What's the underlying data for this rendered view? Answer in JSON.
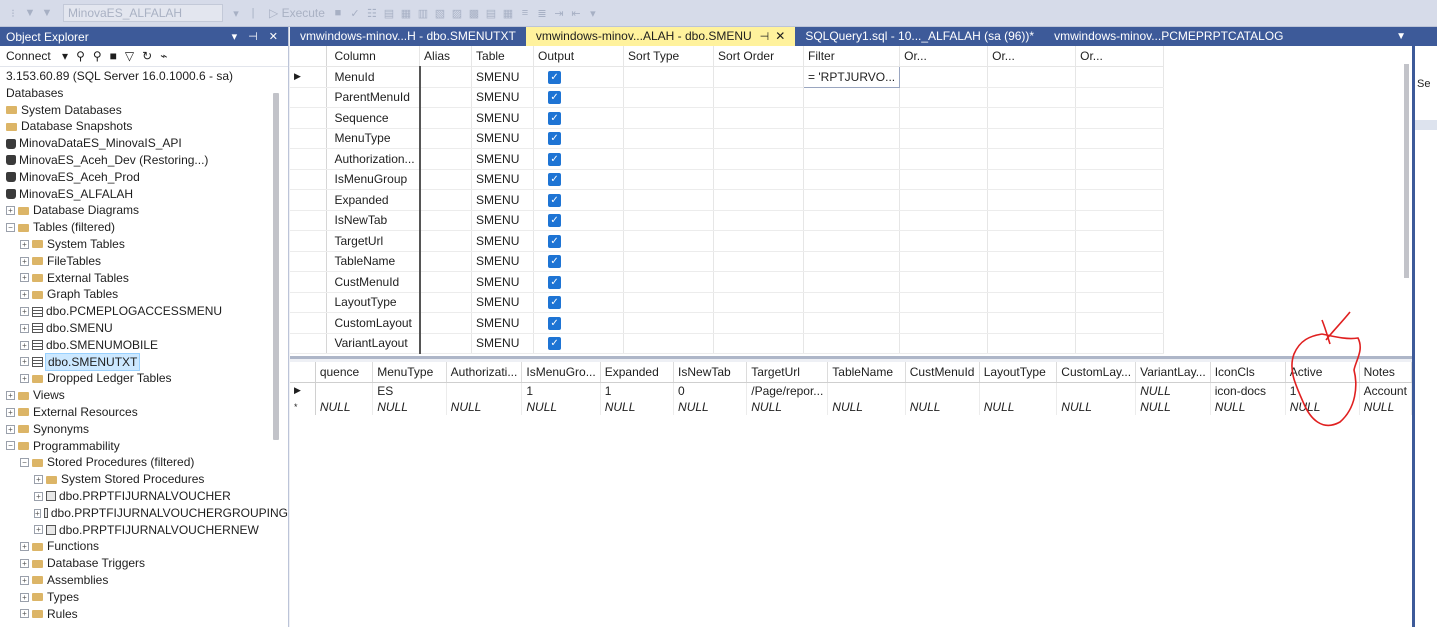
{
  "toolbar": {
    "database": "MinovaES_ALFALAH",
    "execute_label": "Execute"
  },
  "object_explorer": {
    "title": "Object Explorer",
    "connect_label": "Connect",
    "nodes": [
      {
        "label": "3.153.60.89 (SQL Server 16.0.1000.6 - sa)",
        "icon": "server-icon",
        "indent": 0,
        "expander": ""
      },
      {
        "label": "Databases",
        "icon": "",
        "indent": 0,
        "expander": ""
      },
      {
        "label": "System Databases",
        "icon": "folder-icon",
        "indent": 0,
        "expander": ""
      },
      {
        "label": "Database Snapshots",
        "icon": "folder-icon",
        "indent": 0,
        "expander": ""
      },
      {
        "label": "MinovaDataES_MinovaIS_API",
        "icon": "database-icon",
        "indent": 0,
        "expander": ""
      },
      {
        "label": "MinovaES_Aceh_Dev (Restoring...)",
        "icon": "database-icon",
        "indent": 0,
        "expander": ""
      },
      {
        "label": "MinovaES_Aceh_Prod",
        "icon": "database-icon",
        "indent": 0,
        "expander": ""
      },
      {
        "label": "MinovaES_ALFALAH",
        "icon": "database-icon",
        "indent": 0,
        "expander": ""
      },
      {
        "label": "Database Diagrams",
        "icon": "folder-icon",
        "indent": 1,
        "expander": "+"
      },
      {
        "label": "Tables (filtered)",
        "icon": "folder-icon",
        "indent": 1,
        "expander": "−"
      },
      {
        "label": "System Tables",
        "icon": "folder-icon",
        "indent": 2,
        "expander": "+"
      },
      {
        "label": "FileTables",
        "icon": "folder-icon",
        "indent": 2,
        "expander": "+"
      },
      {
        "label": "External Tables",
        "icon": "folder-icon",
        "indent": 2,
        "expander": "+"
      },
      {
        "label": "Graph Tables",
        "icon": "folder-icon",
        "indent": 2,
        "expander": "+"
      },
      {
        "label": "dbo.PCMEPLOGACCESSMENU",
        "icon": "table-icon",
        "indent": 2,
        "expander": "+"
      },
      {
        "label": "dbo.SMENU",
        "icon": "table-icon",
        "indent": 2,
        "expander": "+"
      },
      {
        "label": "dbo.SMENUMOBILE",
        "icon": "table-icon",
        "indent": 2,
        "expander": "+"
      },
      {
        "label": "dbo.SMENUTXT",
        "icon": "table-icon",
        "indent": 2,
        "expander": "+",
        "selected": true
      },
      {
        "label": "Dropped Ledger Tables",
        "icon": "folder-icon",
        "indent": 2,
        "expander": "+"
      },
      {
        "label": "Views",
        "icon": "folder-icon",
        "indent": 1,
        "expander": "+"
      },
      {
        "label": "External Resources",
        "icon": "folder-icon",
        "indent": 1,
        "expander": "+"
      },
      {
        "label": "Synonyms",
        "icon": "folder-icon",
        "indent": 1,
        "expander": "+"
      },
      {
        "label": "Programmability",
        "icon": "folder-icon",
        "indent": 1,
        "expander": "−"
      },
      {
        "label": "Stored Procedures (filtered)",
        "icon": "folder-icon",
        "indent": 2,
        "expander": "−"
      },
      {
        "label": "System Stored Procedures",
        "icon": "folder-icon",
        "indent": 3,
        "expander": "+"
      },
      {
        "label": "dbo.PRPTFIJURNALVOUCHER",
        "icon": "procedure-icon",
        "indent": 3,
        "expander": "+"
      },
      {
        "label": "dbo.PRPTFIJURNALVOUCHERGROUPING",
        "icon": "procedure-icon",
        "indent": 3,
        "expander": "+"
      },
      {
        "label": "dbo.PRPTFIJURNALVOUCHERNEW",
        "icon": "procedure-icon",
        "indent": 3,
        "expander": "+"
      },
      {
        "label": "Functions",
        "icon": "folder-icon",
        "indent": 2,
        "expander": "+"
      },
      {
        "label": "Database Triggers",
        "icon": "folder-icon",
        "indent": 2,
        "expander": "+"
      },
      {
        "label": "Assemblies",
        "icon": "folder-icon",
        "indent": 2,
        "expander": "+"
      },
      {
        "label": "Types",
        "icon": "folder-icon",
        "indent": 2,
        "expander": "+"
      },
      {
        "label": "Rules",
        "icon": "folder-icon",
        "indent": 2,
        "expander": "+"
      }
    ]
  },
  "tabs": [
    {
      "label": "vmwindows-minov...H - dbo.SMENUTXT",
      "active": false
    },
    {
      "label": "vmwindows-minov...ALAH - dbo.SMENU",
      "active": true
    },
    {
      "label": "SQLQuery1.sql - 10..._ALFALAH (sa (96))*",
      "active": false
    },
    {
      "label": "vmwindows-minov...PCMEPRPTCATALOG",
      "active": false
    }
  ],
  "criteria": {
    "headers": [
      "Column",
      "Alias",
      "Table",
      "Output",
      "Sort Type",
      "Sort Order",
      "Filter",
      "Or...",
      "Or...",
      "Or..."
    ],
    "rows": [
      {
        "column": "MenuId",
        "table": "SMENU",
        "filter": "= 'RPTJURVO..."
      },
      {
        "column": "ParentMenuId",
        "table": "SMENU",
        "filter": ""
      },
      {
        "column": "Sequence",
        "table": "SMENU",
        "filter": ""
      },
      {
        "column": "MenuType",
        "table": "SMENU",
        "filter": ""
      },
      {
        "column": "Authorization...",
        "table": "SMENU",
        "filter": ""
      },
      {
        "column": "IsMenuGroup",
        "table": "SMENU",
        "filter": ""
      },
      {
        "column": "Expanded",
        "table": "SMENU",
        "filter": ""
      },
      {
        "column": "IsNewTab",
        "table": "SMENU",
        "filter": ""
      },
      {
        "column": "TargetUrl",
        "table": "SMENU",
        "filter": ""
      },
      {
        "column": "TableName",
        "table": "SMENU",
        "filter": ""
      },
      {
        "column": "CustMenuId",
        "table": "SMENU",
        "filter": ""
      },
      {
        "column": "LayoutType",
        "table": "SMENU",
        "filter": ""
      },
      {
        "column": "CustomLayout",
        "table": "SMENU",
        "filter": ""
      },
      {
        "column": "VariantLayout",
        "table": "SMENU",
        "filter": ""
      }
    ]
  },
  "results": {
    "headers": [
      "quence",
      "MenuType",
      "Authorizati...",
      "IsMenuGro...",
      "Expanded",
      "IsNewTab",
      "TargetUrl",
      "TableName",
      "CustMenuId",
      "LayoutType",
      "CustomLay...",
      "VariantLay...",
      "IconCls",
      "Active",
      "Notes"
    ],
    "rows": [
      {
        "marker": "▶",
        "cells": [
          "",
          "ES",
          "",
          "1",
          "1",
          "0",
          "/Page/repor...",
          "",
          "",
          "",
          "",
          "NULL",
          "icon-docs",
          "1",
          "Account"
        ]
      },
      {
        "marker": "*",
        "cells": [
          "NULL",
          "NULL",
          "NULL",
          "NULL",
          "NULL",
          "NULL",
          "NULL",
          "NULL",
          "NULL",
          "NULL",
          "NULL",
          "NULL",
          "NULL",
          "NULL",
          "NULL"
        ]
      }
    ]
  },
  "right_pane": {
    "text": "Se"
  },
  "colors": {
    "accent": "#3d5a99",
    "active_tab": "#fff29d",
    "checkbox": "#1e74d4",
    "annotation": "#e02020"
  }
}
